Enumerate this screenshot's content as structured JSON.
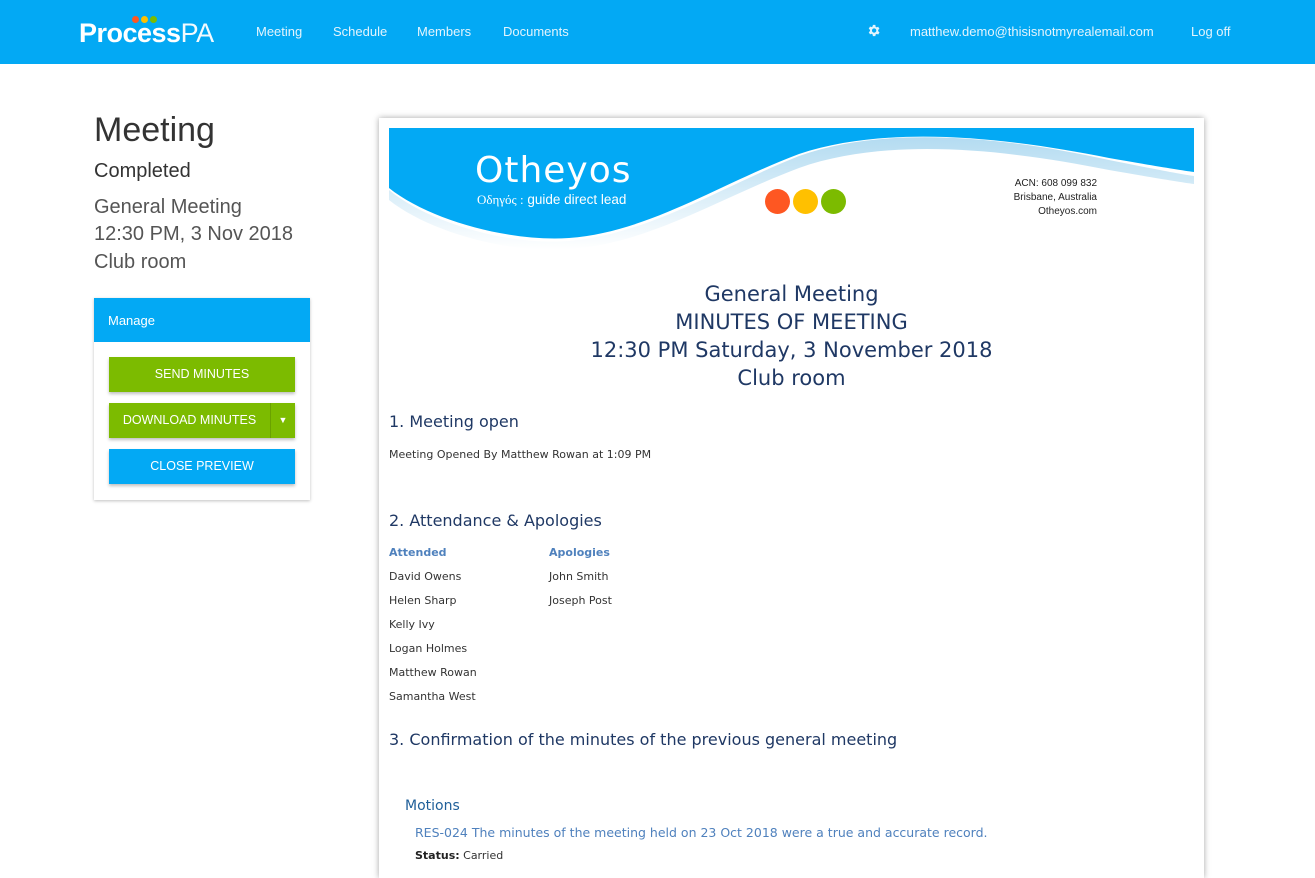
{
  "nav": {
    "brand_bold": "Process",
    "brand_light": "PA",
    "brand_dot_colors": [
      "#fe5722",
      "#ffc000",
      "#7cbb00"
    ],
    "links": [
      "Meeting",
      "Schedule",
      "Members",
      "Documents"
    ],
    "settings_icon": "gear-icon",
    "user_email": "matthew.demo@thisisnotmyrealemail.com",
    "logoff": "Log off"
  },
  "sidebar": {
    "title": "Meeting",
    "status": "Completed",
    "meeting_type": "General Meeting",
    "datetime": "12:30 PM, 3 Nov 2018",
    "location": "Club room",
    "manage": {
      "heading": "Manage",
      "send_label": "SEND MINUTES",
      "download_label": "DOWNLOAD MINUTES",
      "close_label": "CLOSE PREVIEW"
    }
  },
  "document": {
    "letterhead": {
      "company": "Otheyos",
      "tag_greek": "Οδηγός :",
      "tag_english": "guide direct lead",
      "acn": "ACN: 608 099 832",
      "city": "Brisbane, Australia",
      "website": "Otheyos.com",
      "dot_colors": [
        "#fe5722",
        "#ffc000",
        "#7cbb00"
      ],
      "accent": "#03a9f4"
    },
    "heading": {
      "line1": "General Meeting",
      "line2": "MINUTES OF MEETING",
      "line3": "12:30 PM Saturday, 3 November 2018",
      "line4": "Club room"
    },
    "section1": {
      "title": "1. Meeting open",
      "text": "Meeting Opened By Matthew Rowan at 1:09 PM"
    },
    "section2": {
      "title": "2. Attendance & Apologies",
      "attended_label": "Attended",
      "attended": [
        "David Owens",
        "Helen Sharp",
        "Kelly Ivy",
        "Logan Holmes",
        "Matthew Rowan",
        "Samantha West"
      ],
      "apologies_label": "Apologies",
      "apologies": [
        "John Smith",
        "Joseph Post"
      ]
    },
    "section3": {
      "title": "3. Confirmation of the minutes of the previous general meeting",
      "motions_label": "Motions",
      "motion_text": "RES-024 The minutes of the meeting held on 23 Oct 2018 were a true and accurate record.",
      "status_label": "Status:",
      "status_value": "Carried"
    }
  }
}
